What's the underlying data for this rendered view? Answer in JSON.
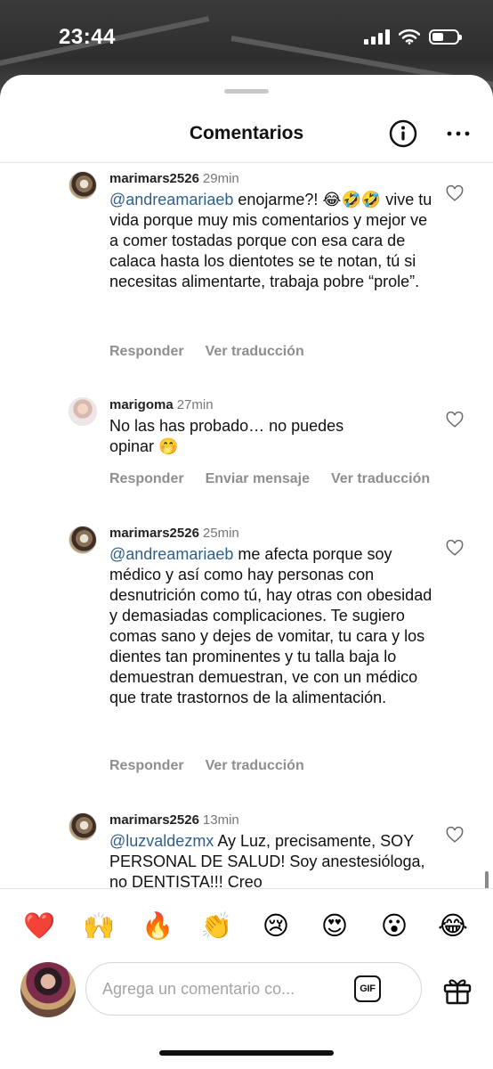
{
  "status_bar": {
    "time": "23:44"
  },
  "header": {
    "title": "Comentarios"
  },
  "comments": [
    {
      "username": "marimars2526",
      "time_ago": "29min",
      "mention": "@andreamariaeb",
      "text": " enojarme?! 😂🤣🤣 vive tu vida porque muy mis comentarios y mejor ve a comer tostadas porque con esa cara de calaca hasta los dientotes se te notan, tú si necesitas alimentarte, trabaja pobre “prole”.",
      "actions": [
        "Responder",
        "Ver traducción"
      ]
    },
    {
      "username": "marigoma",
      "time_ago": "27min",
      "mention": "",
      "text": "No las has probado… no puedes opinar 🤭",
      "actions": [
        "Responder",
        "Enviar mensaje",
        "Ver traducción"
      ]
    },
    {
      "username": "marimars2526",
      "time_ago": "25min",
      "mention": "@andreamariaeb",
      "text": " me afecta porque soy médico y así como hay personas con desnutrición como tú, hay otras con obesidad y demasiadas complicaciones. Te sugiero comas sano y dejes de vomitar, tu cara y los dientes tan prominentes y tu talla baja lo demuestran demuestran, ve con un médico que trate trastornos de la alimentación.",
      "actions": [
        "Responder",
        "Ver traducción"
      ]
    },
    {
      "username": "marimars2526",
      "time_ago": "13min",
      "mention": "@luzvaldezmx",
      "text": " Ay Luz, precisamente, SOY PERSONAL DE SALUD! Soy anestesióloga, no DENTISTA!!! Creo",
      "actions": []
    }
  ],
  "reactions": [
    "❤️",
    "🙌",
    "🔥",
    "👏",
    "😢",
    "😍",
    "😮",
    "😂"
  ],
  "composer": {
    "placeholder": "Agrega un comentario co...",
    "gif_label": "GIF"
  },
  "icons": {
    "info": "info-circle-icon",
    "more": "more-horizontal-icon",
    "like": "heart-outline-icon",
    "gift": "gift-icon",
    "signal": "cellular-signal-icon",
    "wifi": "wifi-icon",
    "battery": "battery-icon"
  },
  "colors": {
    "mention": "#2e5f8a",
    "secondary_text": "#8e8e8e"
  }
}
